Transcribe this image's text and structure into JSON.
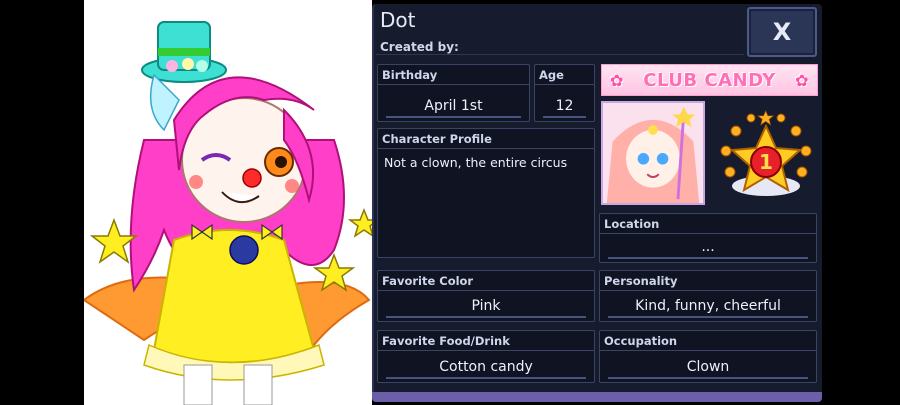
{
  "profile": {
    "name": "Dot",
    "created_by_label": "Created by:",
    "close_label": "X"
  },
  "club": {
    "name": "CLUB CANDY",
    "rank": "1"
  },
  "fields": {
    "birthday": {
      "label": "Birthday",
      "value": "April 1st"
    },
    "age": {
      "label": "Age",
      "value": "12"
    },
    "character_profile": {
      "label": "Character Profile",
      "value": "Not a clown, the entire circus"
    },
    "location": {
      "label": "Location",
      "value": "..."
    },
    "favorite_color": {
      "label": "Favorite Color",
      "value": "Pink"
    },
    "personality": {
      "label": "Personality",
      "value": "Kind, funny, cheerful"
    },
    "favorite_food": {
      "label": "Favorite Food/Drink",
      "value": "Cotton candy"
    },
    "occupation": {
      "label": "Occupation",
      "value": "Clown"
    }
  },
  "colors": {
    "panel_bg": "#161b2e",
    "field_bg": "#0f1322",
    "border": "#3a4464",
    "accent": "#ff6fb8",
    "hair": "#ff3fc8",
    "dress": "#ffee22"
  }
}
